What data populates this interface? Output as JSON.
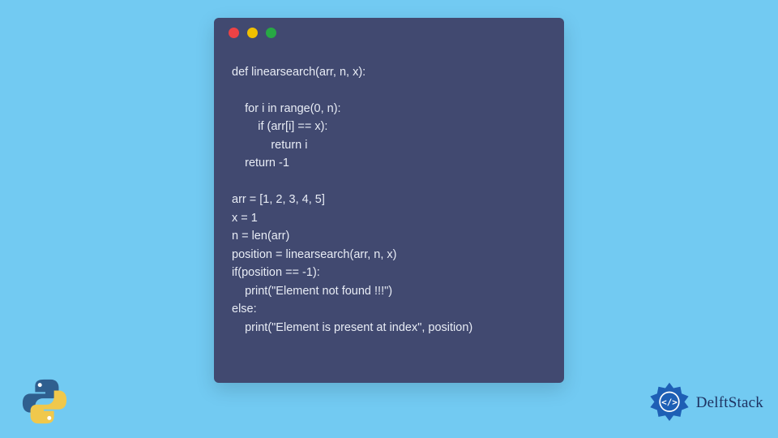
{
  "window": {
    "dots": {
      "red": "#ed4245",
      "yellow": "#f0c000",
      "green": "#27a844"
    }
  },
  "code": {
    "l1": "def linearsearch(arr, n, x):",
    "l2": "",
    "l3": "    for i in range(0, n):",
    "l4": "        if (arr[i] == x):",
    "l5": "            return i",
    "l6": "    return -1",
    "l7": "",
    "l8": "arr = [1, 2, 3, 4, 5]",
    "l9": "x = 1",
    "l10": "n = len(arr)",
    "l11": "position = linearsearch(arr, n, x)",
    "l12": "if(position == -1):",
    "l13": "    print(\"Element not found !!!\")",
    "l14": "else:",
    "l15": "    print(\"Element is present at index\", position)"
  },
  "brand": {
    "name": "DelftStack"
  },
  "colors": {
    "page_bg": "#72caf2",
    "window_bg": "#414970",
    "code_fg": "#e8ecf5",
    "brand_fg": "#1e3362"
  }
}
